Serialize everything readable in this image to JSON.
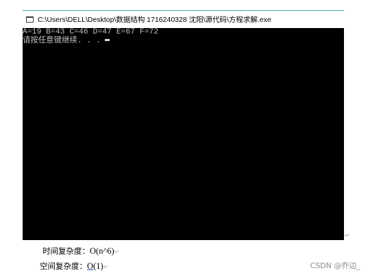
{
  "window": {
    "title": "C:\\Users\\DELL\\Desktop\\数据结构   1716240328  沈阳\\源代码\\方程求解.exe",
    "icon": "console-window-icon"
  },
  "console": {
    "lines": [
      "A=19 B=43 C=46 D=47 E=67 F=72",
      "请按任意键继续. . ."
    ]
  },
  "document": {
    "time_label": "时间复杂度：",
    "time_value": "O(n^6)",
    "space_label": "空间复杂度：",
    "space_value_o": "O",
    "space_value_rest": "(1)",
    "paragraph_mark": "↵"
  },
  "watermark": "CSDN @乔边_"
}
